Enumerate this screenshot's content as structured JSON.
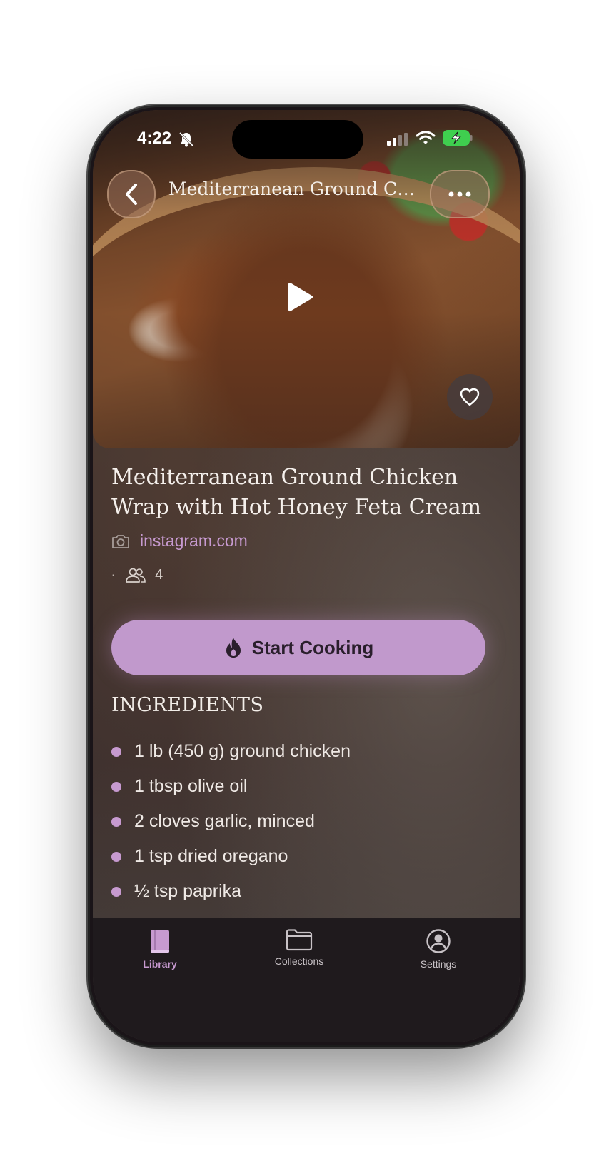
{
  "status_bar": {
    "time": "4:22"
  },
  "header": {
    "title": "Mediterranean Ground Ch..."
  },
  "recipe": {
    "title_line1": "Mediterranean Ground Chicken",
    "title_line2": "Wrap with Hot Honey Feta Cream",
    "source": "instagram.com",
    "separator": "·",
    "servings": "4"
  },
  "actions": {
    "start_cooking": "Start Cooking"
  },
  "ingredients": {
    "heading": "INGREDIENTS",
    "items": [
      "1 lb (450 g) ground chicken",
      "1 tbsp olive oil",
      "2 cloves garlic, minced",
      "1 tsp dried oregano",
      "½ tsp paprika"
    ]
  },
  "tabs": [
    {
      "label": "Library",
      "icon": "book-icon",
      "active": true
    },
    {
      "label": "Collections",
      "icon": "folder-icon",
      "active": false
    },
    {
      "label": "Settings",
      "icon": "person-circle-icon",
      "active": false
    }
  ],
  "colors": {
    "accent": "#c199cc",
    "accent_text": "#c79ad0",
    "tab_bar": "#1f1a1d"
  }
}
